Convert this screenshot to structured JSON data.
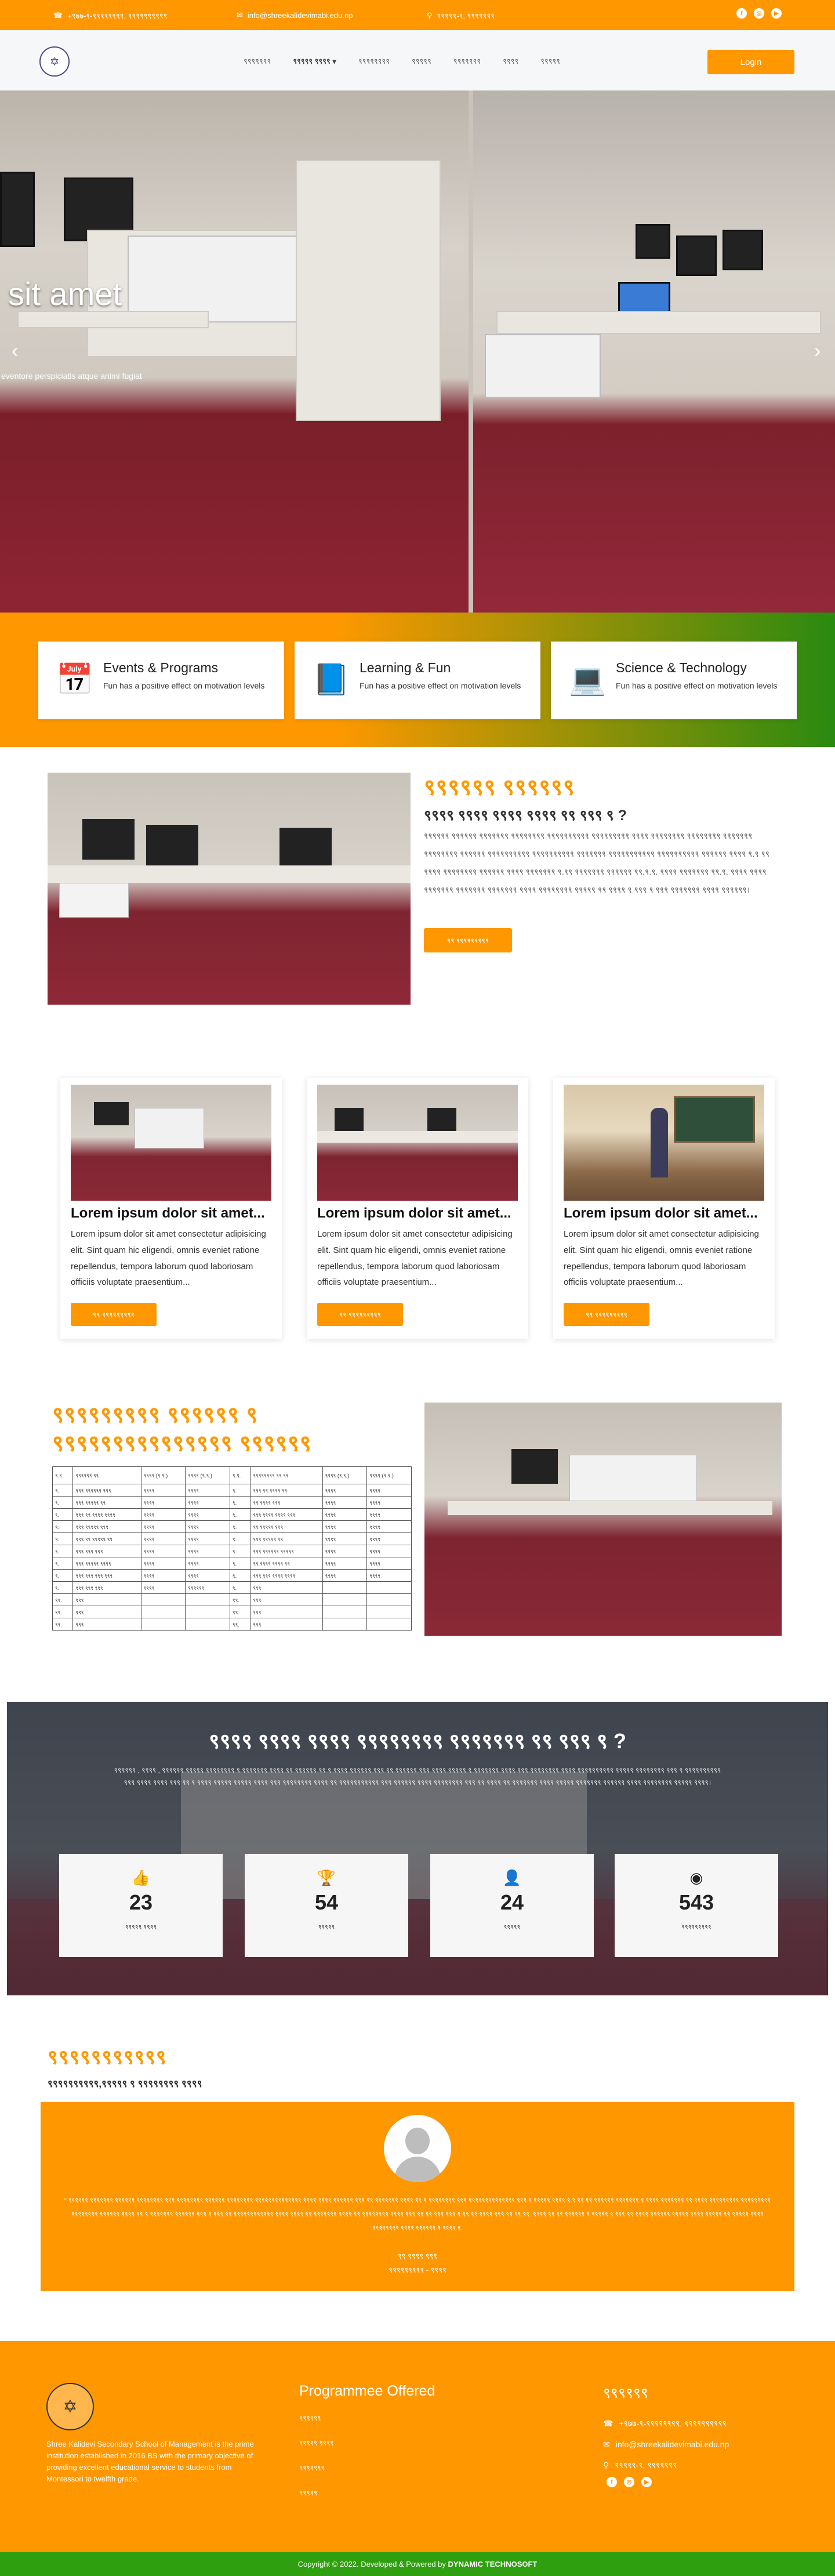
{
  "topbar": {
    "phone": "+९७७-९-९९९९९९९९, ९९९९९९९९९९",
    "email": "info@shreekalidevimabi.edu.np",
    "address": "९९९९९-९, ९९९९९९९"
  },
  "nav": {
    "items": [
      "९९९९९९९",
      "९९९९९ ९९९९",
      "९९९९९९९९",
      "९९९९९",
      "९९९९९९९",
      "९९९९",
      "९९९९९"
    ],
    "login": "Login"
  },
  "hero": {
    "title": "sit amet",
    "subtitle": "eventore perspiciatis atque animi fugiat",
    "prev": "‹",
    "next": "›"
  },
  "features": [
    {
      "icon": "calendar-icon",
      "title": "Events & Programs",
      "desc": "Fun has a positive effect on motivation levels"
    },
    {
      "icon": "book-icon",
      "title": "Learning & Fun",
      "desc": "Fun has a positive effect on motivation levels"
    },
    {
      "icon": "laptop-icon",
      "title": "Science & Technology",
      "desc": "Fun has a positive effect on motivation levels"
    }
  ],
  "about": {
    "heading": "९९९९९९ ९९९९९९",
    "question": "९९९९ ९९९९ ९९९९ ९९९९ ९९ ९९९ ९ ?",
    "text": "९९९९९९ ९९९९९९ ९९९९९९९ ९९९९९९९९ ९९९९९९९९९९ ९९९९९९९९९ ९९९९ ९९९९९९९९ ९९९९९९९९ ९९९९९९९ ९९९९९९९९ ९९९९९९ ९९९९९९९९९९ ९९९९९९९९९९ ९९९९९९९ ९९९९९९९९९९९ ९९९९९९९९९९ ९९९९९९ ९९९९ ९.९ ९९  ९९९९ ९९९९९९९९ ९९९९९९ ९९९९ ९९९९९९९ ९.९९ ९९९९९९९ ९९९९९९ ९९.९.९. ९९९९ ९९९९९९९ ९९.९. ९९९९ ९९९९ ९९९९९९९ ९९९९९९९ ९९९९९९९ ९९९९ ९९९९९९९९ ९९९९९ ९९ ९९९९ ९ ९९९ ९ ९९९ ९९९९९९९ ९९९९ ९९९९९९।",
    "button": "९९ ९९९९९९९९९"
  },
  "programs": [
    {
      "title": "Lorem ipsum dolor sit amet...",
      "desc": "Lorem ipsum dolor sit amet consectetur adipisicing elit. Sint quam hic eligendi, omnis eveniet ratione repellendus, tempora laborum quod laboriosam officiis voluptate praesentium...",
      "button": "९९ ९९९९९९९९९"
    },
    {
      "title": "Lorem ipsum dolor sit amet...",
      "desc": "Lorem ipsum dolor sit amet consectetur adipisicing elit. Sint quam hic eligendi, omnis eveniet ratione repellendus, tempora laborum quod laboriosam officiis voluptate praesentium...",
      "button": "९९ ९९९९९९९९९"
    },
    {
      "title": "Lorem ipsum dolor sit amet...",
      "desc": "Lorem ipsum dolor sit amet consectetur adipisicing elit. Sint quam hic eligendi, omnis eveniet ratione repellendus, tempora laborum quod laboriosam officiis voluptate praesentium...",
      "button": "९९ ९९९९९९९९९"
    }
  ],
  "table_section": {
    "heading": "९९९९९९९९९ ९९९९९९ ९ ९९९९९९९९९९९९९९९ ९९९९९९",
    "headers": [
      "९.९.",
      "९९९९९९ ९९",
      "९९९९ (९.९.)",
      "९९९९ (९.९.)",
      "९.९.",
      "९९९९९९९९ ९९ ९९",
      "९९९९ (९.९.)",
      "९९९९ (९.९.)"
    ],
    "rows": [
      [
        "९.",
        "९९९ ९९९९९९ ९९९",
        "९९९९",
        "९९९९",
        "९.",
        "९९९ ९९ ९९९९ ९९",
        "९९९९",
        "९९९९"
      ],
      [
        "९.",
        "९९९ ९९९९९ ९९",
        "९९९९",
        "९९९९",
        "९.",
        "९९ ९९९९ ९९९",
        "९९९९",
        "९९९९"
      ],
      [
        "९.",
        "९९९ ९९ ९९९९ ९९९९",
        "९९९९",
        "९९९९",
        "९.",
        "९९९ ९९९९ ९९९९ ९९९",
        "९९९९",
        "९९९९"
      ],
      [
        "९.",
        "९९९ ९९९९९ ९९९",
        "९९९९",
        "९९९९",
        "९.",
        "९९ ९९९९९ ९९९",
        "९९९९",
        "९९९९"
      ],
      [
        "९.",
        "९९९ ९९ ९९९९९ ९९",
        "९९९९",
        "९९९९",
        "९.",
        "९९९ ९९९९९ ९९",
        "९९९९",
        "९९९९"
      ],
      [
        "९.",
        "९९९ ९९९ ९९९",
        "९९९९",
        "९९९९",
        "९.",
        "९९९ ९९९९९९ ९९९९९",
        "९९९९",
        "९९९९"
      ],
      [
        "९.",
        "९९९ ९९९९९ ९९९९",
        "९९९९",
        "९९९९",
        "९.",
        "९९ ९९९९ ९९९९ ९९",
        "९९९९",
        "९९९९"
      ],
      [
        "९.",
        "९९९ ९९९ ९९९ ९९९",
        "९९९९",
        "९९९९",
        "९.",
        "९९९ ९९९ ९९९९ ९९९९",
        "९९९९",
        "९९९९"
      ],
      [
        "९.",
        "९९९ ९९९ ९९९",
        "९९९९",
        "९९९९९९",
        "९.",
        "९९९",
        "",
        ""
      ],
      [
        "९९.",
        "९९९",
        "",
        "",
        "९९.",
        "९९९",
        "",
        ""
      ],
      [
        "९९.",
        "९९९",
        "",
        "",
        "९९.",
        "९९९",
        "",
        ""
      ],
      [
        "९९.",
        "९९९",
        "",
        "",
        "९९.",
        "९९९",
        "",
        ""
      ]
    ]
  },
  "stats": {
    "heading": "९९९९ ९९९९ ९९९९ ९९९९९९९९ ९९९९९९९ ९९ ९९९ ९ ?",
    "text": "९९९९९९ , ९९९९ , ९९९९९९ ९९९९९ ९९९९९९९९ ९ ९९९९९९९ ९९९९ ९९ ९९९९९९ ९९ ९ ९९९९ ९९९९९९ ९९९ ९९ ९९९९९९ ९९९ ९९९९ ९९९९९ ९ ९९९९९९९ ९९९९ ९९९ ९९९९९९९९ ९९९९ ९९९९९९९९९९ ९९९९९ ९९९९९९९९ ९९९ ९ ९९९९९९९९९९ ९९९ ९९९९ ९९९९ ९९९ ९९ ९ ९९९९ ९९९९९ ९९९९९ ९९९९ ९९९ ९९९९९९९९ ९९९९ ९९ ९९९९९९९९९९९ ९९९ ९९९९९९ ९९९९ ९९९९९९९९ ९९९ ९९ ९९९९ ९९ ९९९९९९९ ९९९९ ९९९९९ ९९९९९९९ ९९९९९९ ९९९९ ९९९९९९९९ ९९९९९ ९९९९।",
    "items": [
      {
        "icon": "thumbs-up-icon",
        "glyph": "👍",
        "value": "23",
        "label": "९९९९९ ९९९९"
      },
      {
        "icon": "trophy-icon",
        "glyph": "🏆",
        "value": "54",
        "label": "९९९९९"
      },
      {
        "icon": "user-icon",
        "glyph": "👤",
        "value": "24",
        "label": "९९९९९"
      },
      {
        "icon": "user-circle-icon",
        "glyph": "◉",
        "value": "543",
        "label": "९९९९९९९९९"
      }
    ]
  },
  "testimonial": {
    "heading": "९९९९९९९९९९९",
    "subtitle": "९९९९९९९९९९,९९९९९ ९ ९९९९९९९९ ९९९९",
    "quote": "“  ९९९९९९ ९९९९९९९ ९९९९९९ ९९९९९९९९ ९९९ ९९९९९९९९ ९९९९९९ ९९९९९९९९ ९९९९९९९९९९९९९९ ९९९९ ९९९९ ९९९९९९ ९९९ ९९ ९९९९९९९ ९९९९ ९९ ९ ९९९९९९९९ ९९९ ९९९९९९९९९९९९९९ ९९९ ९ ९९९९९ ९९९९ ९.९ ९९ ९९ ९९९९९९ ९९९९९९९ ९ ९९९९ ९९९९९९९ ९९ ९९९९ ९९९९९९९९९ ९९९९९९९९९ ९९९९९९९९ ९९९९९९ ९९९९ ९९ ९ ९९९९९९९ ९९९९९९ ९९९ ९ ९९९ ९९ ९९९९९९९९९९९९ ९९९९ ९९९९ ९९ ९९९९९९९ ९९९९ ९९ ९९९९९९९९ ९९९९ ९९९ ९९ ९९ ९९९ ९९९ ९ ९९ ९९ ९९९९ ९९९ ९९ ९९.९९. ९९९९ ९९ ९९ ९९९९९९ ९ ९९९९९ ९ ९९९ ९९ ९९९९ ९९९९९९ ९९९९९ ९९९९ ९९९९९ ९९ ९९९९९ ९९९९ ९९९९९९९९ ९९९९ ९९९९९९ ९ ९९९९ ९.",
    "name": "९९ ९९९९ ९९९",
    "role": "९९९९९९९९९ - ९९९९"
  },
  "footer": {
    "description": "Shree Kalidevi Secondary School of Management is the prime institution established in 2016 BS with the primary objective of providing excellent educational service to students from Montessori to twelfth grade.",
    "programs_heading": "Programmee Offered",
    "programs": [
      "९९९९९९",
      "९९९९९ ९९९९",
      "९९९९९९९",
      "९९९९९"
    ],
    "contact_heading": "९९९९९९",
    "phone": "+९७७-९-९९९९९९९९, ९९९९९९९९९९",
    "email": "info@shreekalidevimabi.edu.np",
    "address": "९९९९९-९, ९९९९९९९"
  },
  "copyright": {
    "text": "Copyright © 2022. Developed & Powered by",
    "company": "DYNAMIC TECHNOSOFT"
  },
  "colors": {
    "accent": "#ff9800",
    "green": "#2e9f0e"
  }
}
